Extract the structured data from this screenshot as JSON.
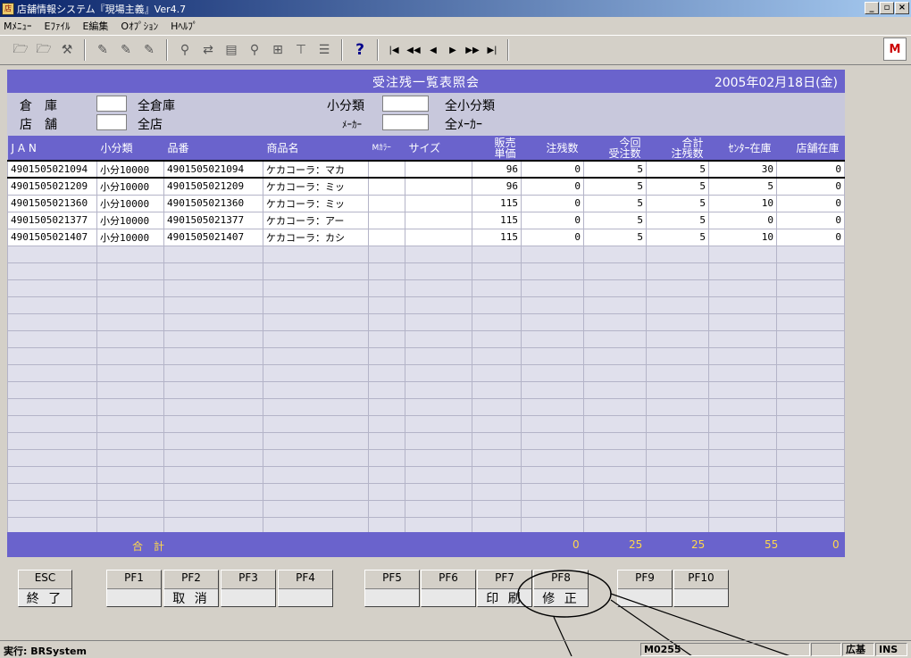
{
  "window": {
    "title": "店舗情報システム『現場主義』Ver4.7"
  },
  "menu": [
    "Mﾒﾆｭｰ",
    "Eﾌｧｲﾙ",
    "E編集",
    "Oｵﾌﾟｼｮﾝ",
    "Hﾍﾙﾌﾟ"
  ],
  "screen": {
    "title": "受注残一覧表照会",
    "date": "2005年02月18日(金)"
  },
  "filters": {
    "warehouse_label": "倉　庫",
    "warehouse_all": "全倉庫",
    "store_label": "店　舗",
    "store_all": "全店",
    "subcat_label": "小分類",
    "subcat_all": "全小分類",
    "maker_label": "ﾒｰｶｰ",
    "maker_all": "全ﾒｰｶｰ"
  },
  "table": {
    "headers": [
      "J A N",
      "小分類",
      "品番",
      "商品名",
      "Mｶﾗｰ",
      "サイズ",
      "販売\n単価",
      "注残数",
      "今回\n受注数",
      "合計\n注残数",
      "ｾﾝﾀｰ在庫",
      "店舗在庫"
    ],
    "rows": [
      [
        "4901505021094",
        "小分10000",
        "4901505021094",
        "ケカコーラ：マカ",
        "",
        "",
        "96",
        "0",
        "5",
        "5",
        "30",
        "0"
      ],
      [
        "4901505021209",
        "小分10000",
        "4901505021209",
        "ケカコーラ：ミッ",
        "",
        "",
        "96",
        "0",
        "5",
        "5",
        "5",
        "0"
      ],
      [
        "4901505021360",
        "小分10000",
        "4901505021360",
        "ケカコーラ：ミッ",
        "",
        "",
        "115",
        "0",
        "5",
        "5",
        "10",
        "0"
      ],
      [
        "4901505021377",
        "小分10000",
        "4901505021377",
        "ケカコーラ：アー",
        "",
        "",
        "115",
        "0",
        "5",
        "5",
        "0",
        "0"
      ],
      [
        "4901505021407",
        "小分10000",
        "4901505021407",
        "ケカコーラ：カシ",
        "",
        "",
        "115",
        "0",
        "5",
        "5",
        "10",
        "0"
      ]
    ]
  },
  "totals": {
    "label": "合　計",
    "chuzan": "0",
    "konkai": "25",
    "gokei": "25",
    "center": "55",
    "store": "0"
  },
  "fkeys": [
    {
      "key": "ESC",
      "label": "終 了"
    },
    {
      "key": "PF1",
      "label": ""
    },
    {
      "key": "PF2",
      "label": "取 消"
    },
    {
      "key": "PF3",
      "label": ""
    },
    {
      "key": "PF4",
      "label": ""
    },
    {
      "key": "PF5",
      "label": ""
    },
    {
      "key": "PF6",
      "label": ""
    },
    {
      "key": "PF7",
      "label": "印 刷"
    },
    {
      "key": "PF8",
      "label": "修 正"
    },
    {
      "key": "PF9",
      "label": ""
    },
    {
      "key": "PF10",
      "label": ""
    }
  ],
  "status": {
    "exec": "実行: BRSystem",
    "code": "M0255",
    "mode1": "広基",
    "mode2": "INS"
  }
}
